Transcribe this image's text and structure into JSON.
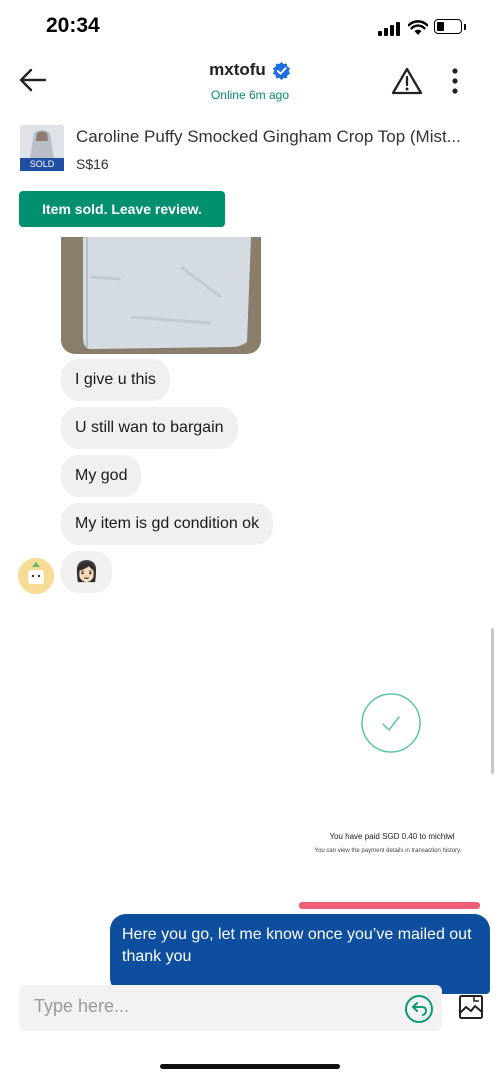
{
  "status_bar": {
    "time": "20:34"
  },
  "header": {
    "username": "mxtofu",
    "online_status": "Online 6m ago",
    "icons": {
      "back": "back-arrow-icon",
      "report": "warning-icon",
      "more": "more-vertical-icon",
      "verified": "verified-badge-icon"
    }
  },
  "listing": {
    "title": "Caroline Puffy Smocked Gingham Crop Top (Mist...",
    "price": "S$16",
    "badge": "SOLD",
    "review_button": "Item sold. Leave review."
  },
  "messages": [
    {
      "from": "seller",
      "text": "I give u this"
    },
    {
      "from": "seller",
      "text": "U still wan to bargain"
    },
    {
      "from": "seller",
      "text": "My god"
    },
    {
      "from": "seller",
      "text": "My item is gd condition ok"
    },
    {
      "from": "seller",
      "text": "👩🏻"
    }
  ],
  "payment": {
    "title": "You have paid SGD 0.40 to michlwl",
    "subtitle": "You can view the payment details in transaction history."
  },
  "outgoing": {
    "text": "Here you go, let me know once you’ve mailed out thank you"
  },
  "composer": {
    "placeholder": "Type here..."
  },
  "colors": {
    "brand_green": "#008f6f",
    "outgoing_bubble": "#0d4f9e",
    "sold_badge": "#1f4ea3",
    "accent_pink": "#ee5e74"
  }
}
